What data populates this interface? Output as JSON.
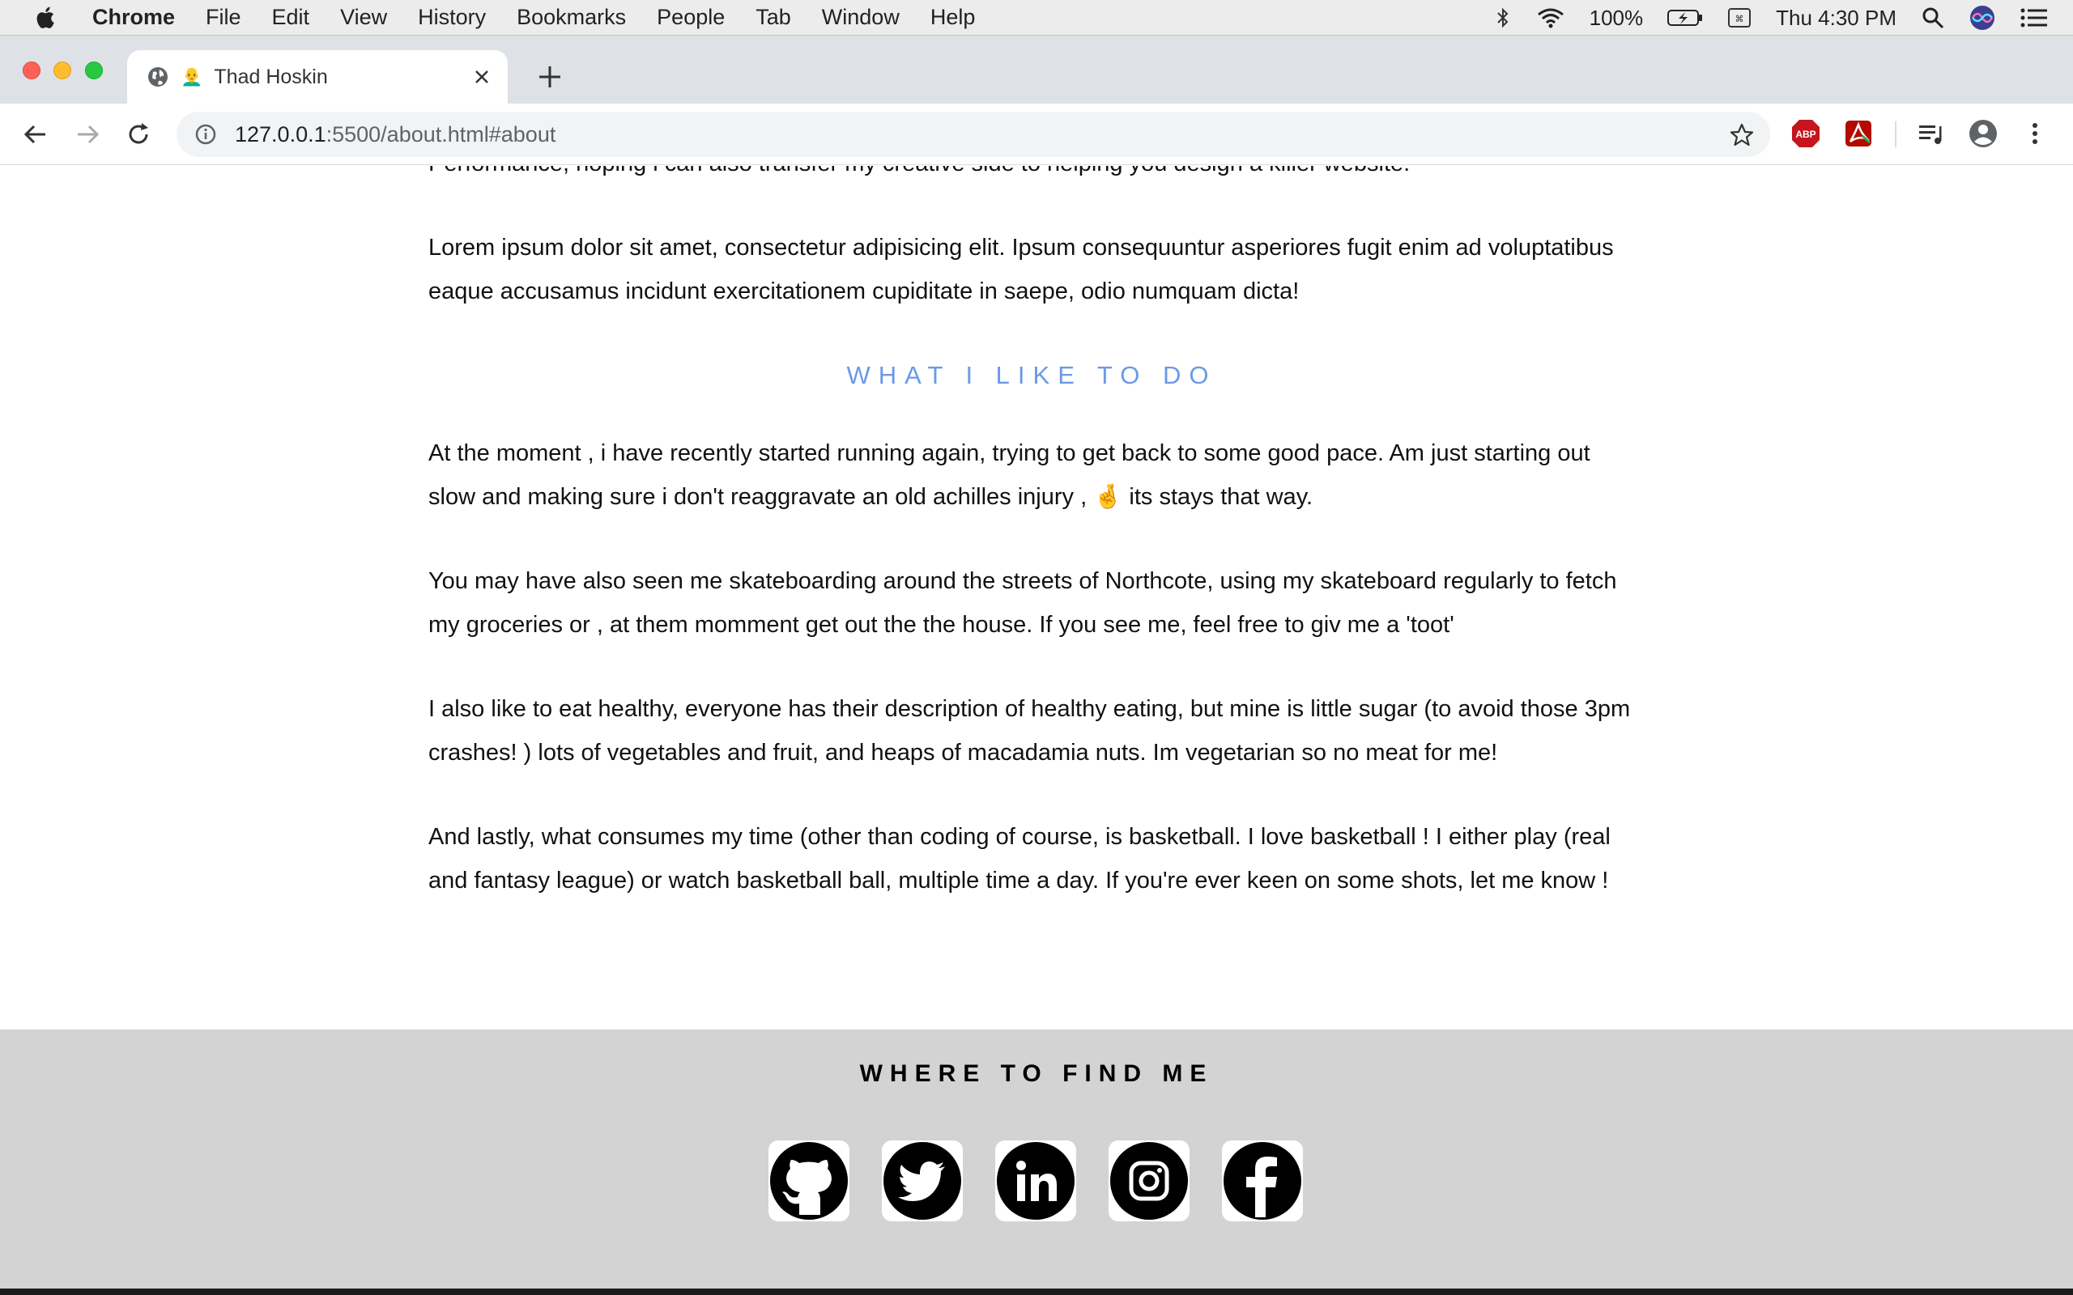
{
  "menubar": {
    "app_name": "Chrome",
    "items": [
      "File",
      "Edit",
      "View",
      "History",
      "Bookmarks",
      "People",
      "Tab",
      "Window",
      "Help"
    ],
    "battery": "100%",
    "clock": "Thu 4:30 PM"
  },
  "tab": {
    "title": "Thad Hoskin",
    "favicon": "👨‍🦲"
  },
  "address_bar": {
    "host": "127.0.0.1",
    "rest": ":5500/about.html#about"
  },
  "article": {
    "cut_line": "Performance, hoping i can also transfer my creative side to helping you design a killer website.",
    "lorem": "Lorem ipsum dolor sit amet, consectetur adipisicing elit. Ipsum consequuntur asperiores fugit enim ad voluptatibus eaque accusamus incidunt exercitationem cupiditate in saepe, odio numquam dicta!",
    "heading": "WHAT I LIKE TO DO",
    "running_before": "At the moment , i have recently started running again, trying to get back to some good pace. Am just starting out slow and making sure i don't reaggravate an old achilles injury ,",
    "running_emoji": "🤞",
    "running_after": " its stays that way.",
    "skate": "You may have also seen me skateboarding around the streets of Northcote, using my skateboard regularly to fetch my groceries or , at them momment get out the the house. If you see me, feel free to giv me a 'toot'",
    "food": "I also like to eat healthy, everyone has their description of healthy eating, but mine is little sugar (to avoid those 3pm crashes! ) lots of vegetables and fruit, and heaps of macadamia nuts. Im vegetarian so no meat for me!",
    "basketball": "And lastly, what consumes my time (other than coding of course, is basketball. I love basketball ! I either play (real and fantasy league) or watch basketball ball, multiple time a day. If you're ever keen on some shots, let me know !"
  },
  "footer": {
    "heading": "WHERE TO FIND ME",
    "socials": [
      "github-icon",
      "twitter-icon",
      "linkedin-icon",
      "instagram-icon",
      "facebook-icon"
    ]
  },
  "colors": {
    "accent_heading": "#6b9ae6",
    "footer_bg": "#d3d3d3"
  }
}
